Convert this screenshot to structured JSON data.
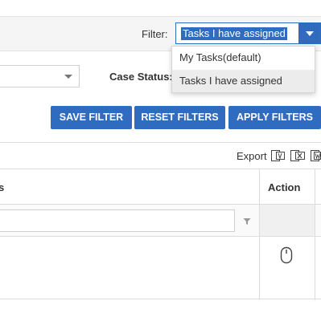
{
  "filter_bar": {
    "label": "Filter:",
    "selected_value": "Tasks I have assigned"
  },
  "dropdown": {
    "options": [
      {
        "label": "My Tasks(default)",
        "selected": false
      },
      {
        "label": "Tasks I have assigned",
        "selected": true
      }
    ]
  },
  "criteria": {
    "case_status_label": "Case Status:"
  },
  "buttons": {
    "save_filter": "SAVE FILTER",
    "reset_filters": "RESET FILTERS",
    "apply_filters": "APPLY FILTERS"
  },
  "export": {
    "label": "Export",
    "icons": [
      "pdf-icon",
      "excel-icon",
      "word-icon"
    ]
  },
  "grid": {
    "columns": [
      {
        "label": "s"
      },
      {
        "label": "Action"
      }
    ],
    "row_action_icon": "mouse-icon"
  },
  "colors": {
    "accent": "#2f6bbf",
    "border": "#dcdcdc",
    "topbar_bg": "#f5f5f5"
  }
}
